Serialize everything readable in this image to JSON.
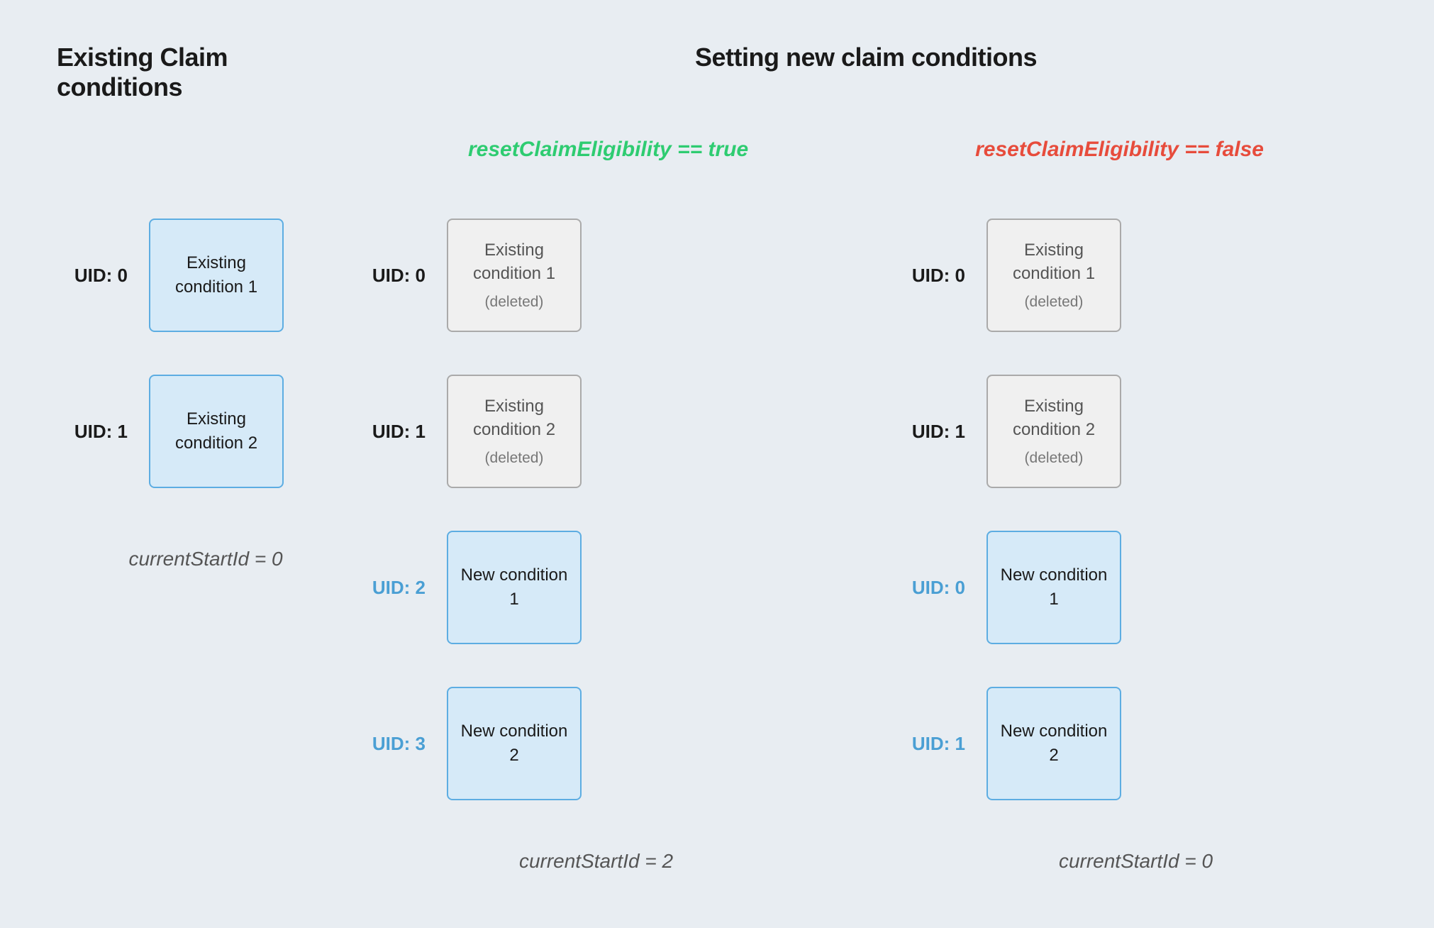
{
  "leftTitle": "Existing Claim conditions",
  "rightTitle": "Setting new claim conditions",
  "subtitleTrue": "resetClaimEligibility == true",
  "subtitleFalse": "resetClaimEligibility == false",
  "leftColumn": {
    "items": [
      {
        "uid": "UID: 0",
        "label": "Existing\ncondition 1"
      },
      {
        "uid": "UID: 1",
        "label": "Existing\ncondition 2"
      }
    ],
    "startId": "currentStartId = 0"
  },
  "trueScenario": {
    "items": [
      {
        "uid": "UID: 0",
        "label": "Existing\ncondition 1",
        "deleted": true,
        "isNew": false
      },
      {
        "uid": "UID: 1",
        "label": "Existing\ncondition 2",
        "deleted": true,
        "isNew": false
      },
      {
        "uid": "UID: 2",
        "label": "New condition\n1",
        "deleted": false,
        "isNew": true
      },
      {
        "uid": "UID: 3",
        "label": "New condition\n2",
        "deleted": false,
        "isNew": true
      }
    ],
    "startId": "currentStartId = 2"
  },
  "falseScenario": {
    "items": [
      {
        "uid": "UID: 0",
        "label": "Existing\ncondition 1",
        "deleted": true,
        "isNew": false
      },
      {
        "uid": "UID: 1",
        "label": "Existing\ncondition 2",
        "deleted": true,
        "isNew": false
      },
      {
        "uid": "UID: 0",
        "label": "New condition\n1",
        "deleted": false,
        "isNew": true
      },
      {
        "uid": "UID: 1",
        "label": "New condition\n2",
        "deleted": false,
        "isNew": true
      }
    ],
    "startId": "currentStartId = 0"
  }
}
